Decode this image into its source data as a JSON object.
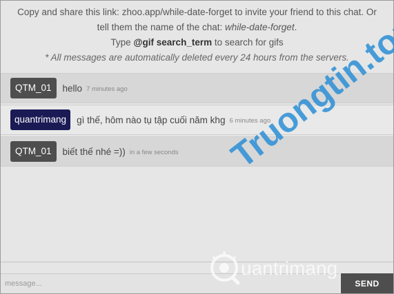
{
  "intro": {
    "line1_prefix": "Copy and share this link: ",
    "link": "zhoo.app/while-date-forget",
    "line1_suffix": " to invite your friend to this chat. Or",
    "line2_prefix": "tell them the name of the chat: ",
    "chat_name": "while-date-forget",
    "line2_suffix": ".",
    "line3_prefix": "Type ",
    "gif_command": "@gif search_term",
    "line3_suffix": " to search for gifs",
    "note": "* All messages are automatically deleted every 24 hours from the servers."
  },
  "messages": [
    {
      "user": "QTM_01",
      "text": "hello",
      "time": "7 minutes ago"
    },
    {
      "user": "quantrimang",
      "text": "gì thế, hôm nào tụ tập cuối năm khg",
      "time": "6 minutes ago"
    },
    {
      "user": "QTM_01",
      "text": "biết thế nhé =))",
      "time": "in a few seconds"
    }
  ],
  "input": {
    "placeholder": "message...",
    "send_label": "SEND"
  },
  "watermark": {
    "logo_text": "Truongtin.top",
    "brand_text": "uantrimang"
  },
  "colors": {
    "badge_default": "#4e4e4e",
    "badge_highlight": "#1b1a55",
    "watermark_blue": "#2b8fd6",
    "watermark_orange": "#f07b2a"
  }
}
